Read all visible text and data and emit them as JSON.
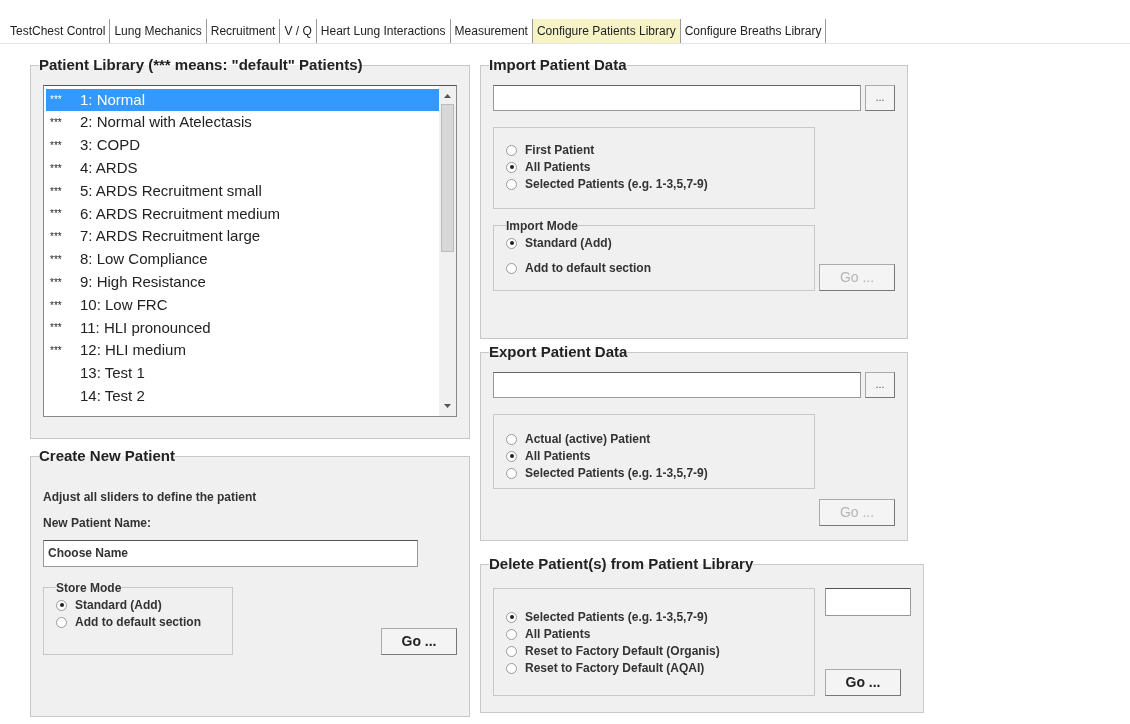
{
  "tabs": [
    {
      "label": "TestChest Control",
      "selected": false
    },
    {
      "label": "Lung Mechanics",
      "selected": false
    },
    {
      "label": "Recruitment",
      "selected": false
    },
    {
      "label": "V / Q",
      "selected": false
    },
    {
      "label": "Heart Lung Interactions",
      "selected": false
    },
    {
      "label": "Measurement",
      "selected": false
    },
    {
      "label": "Configure Patients Library",
      "selected": true
    },
    {
      "label": "Configure Breaths Library",
      "selected": false
    }
  ],
  "patient_library": {
    "title": "Patient Library (*** means: \"default\" Patients)",
    "items": [
      {
        "marker": "***",
        "label": "1: Normal",
        "selected": true
      },
      {
        "marker": "***",
        "label": "2: Normal with Atelectasis",
        "selected": false
      },
      {
        "marker": "***",
        "label": "3: COPD",
        "selected": false
      },
      {
        "marker": "***",
        "label": "4: ARDS",
        "selected": false
      },
      {
        "marker": "***",
        "label": "5: ARDS Recruitment small",
        "selected": false
      },
      {
        "marker": "***",
        "label": "6: ARDS Recruitment medium",
        "selected": false
      },
      {
        "marker": "***",
        "label": "7: ARDS Recruitment large",
        "selected": false
      },
      {
        "marker": "***",
        "label": "8: Low Compliance",
        "selected": false
      },
      {
        "marker": "***",
        "label": "9: High Resistance",
        "selected": false
      },
      {
        "marker": "***",
        "label": "10: Low FRC",
        "selected": false
      },
      {
        "marker": "***",
        "label": "11: HLI pronounced",
        "selected": false
      },
      {
        "marker": "***",
        "label": "12: HLI medium",
        "selected": false
      },
      {
        "label": "13: Test 1",
        "selected": false
      },
      {
        "label": "14: Test 2",
        "selected": false
      }
    ]
  },
  "create_new_patient": {
    "title": "Create New Patient",
    "hint": "Adjust all sliders to define the patient",
    "name_label": "New Patient Name:",
    "name_value": "Choose Name",
    "store_mode": {
      "title": "Store Mode",
      "options": [
        {
          "label": "Standard (Add)",
          "selected": true
        },
        {
          "label": "Add to default section",
          "selected": false
        }
      ]
    },
    "go_button": {
      "label": "Go ...",
      "disabled": false
    }
  },
  "import_patient_data": {
    "title": "Import Patient Data",
    "browse_button": "...",
    "options": [
      {
        "label": "First Patient",
        "selected": false
      },
      {
        "label": "All Patients",
        "selected": true
      },
      {
        "label": "Selected Patients (e.g. 1-3,5,7-9)",
        "selected": false
      }
    ],
    "import_mode": {
      "title": "Import Mode",
      "options": [
        {
          "label": "Standard (Add)",
          "selected": true
        },
        {
          "label": "Add to default section",
          "selected": false
        }
      ]
    },
    "go_button": {
      "label": "Go ...",
      "disabled": true
    }
  },
  "export_patient_data": {
    "title": "Export Patient Data",
    "browse_button": "...",
    "options": [
      {
        "label": "Actual (active) Patient",
        "selected": false
      },
      {
        "label": "All Patients",
        "selected": true
      },
      {
        "label": "Selected Patients (e.g. 1-3,5,7-9)",
        "selected": false
      }
    ],
    "go_button": {
      "label": "Go ...",
      "disabled": true
    }
  },
  "delete_patients": {
    "title": "Delete Patient(s) from Patient Library",
    "options": [
      {
        "label": "Selected Patients (e.g. 1-3,5,7-9)",
        "selected": true
      },
      {
        "label": "All Patients",
        "selected": false
      },
      {
        "label": "Reset to Factory Default (Organis)",
        "selected": false
      },
      {
        "label": "Reset to Factory Default (AQAI)",
        "selected": false
      }
    ],
    "go_button": {
      "label": "Go ...",
      "disabled": false
    }
  }
}
